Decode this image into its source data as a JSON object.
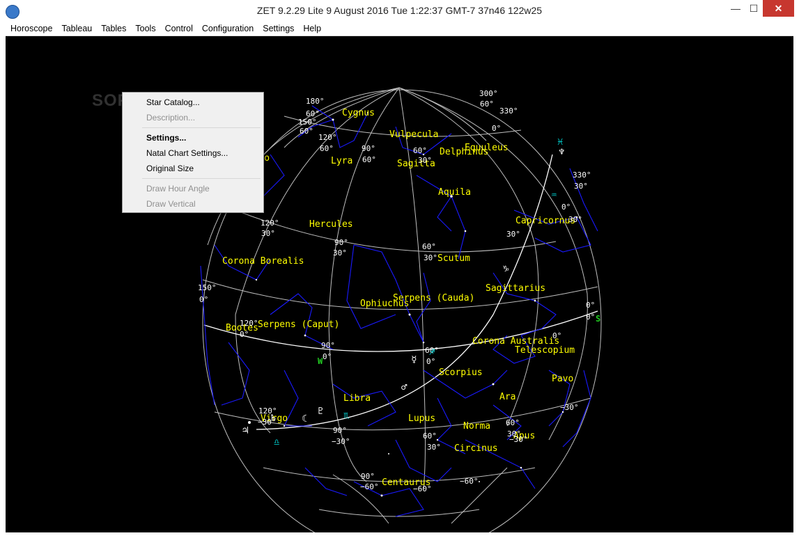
{
  "window": {
    "title": "ZET 9.2.29 Lite     9 August 2016  Tue    1:22:37 GMT-7 37n46   122w25",
    "min_glyph": "—",
    "max_glyph": "☐",
    "close_glyph": "✕"
  },
  "menu": [
    "Horoscope",
    "Tableau",
    "Tables",
    "Tools",
    "Control",
    "Configuration",
    "Settings",
    "Help"
  ],
  "context_menu": {
    "items": [
      {
        "label": "Star Catalog...",
        "enabled": true,
        "bold": false
      },
      {
        "label": "Description...",
        "enabled": false,
        "bold": false
      },
      {
        "label": "Settings...",
        "enabled": true,
        "bold": true
      },
      {
        "label": "Natal Chart Settings...",
        "enabled": true,
        "bold": false
      },
      {
        "label": "Original Size",
        "enabled": true,
        "bold": false
      },
      {
        "label": "Draw Hour Angle",
        "enabled": false,
        "bold": false
      },
      {
        "label": "Draw Vertical",
        "enabled": false,
        "bold": false
      }
    ]
  },
  "watermark": "SOFTPEDIA",
  "constellations": [
    "Cygnus",
    "Vulpecula",
    "Delphinus",
    "Equuleus",
    "Draco",
    "Lyra",
    "Sagitta",
    "Aquila",
    "Hercules",
    "Capricornus",
    "Corona Borealis",
    "Scutum",
    "Sagittarius",
    "Ophiuchus",
    "Serpens (Cauda)",
    "Bootes",
    "Serpens (Caput)",
    "Corona Australis",
    "Telescopium",
    "Scorpius",
    "Pavo",
    "Libra",
    "Ara",
    "Virgo",
    "Lupus",
    "Norma",
    "Apus",
    "Circinus",
    "Centaurus"
  ],
  "grid_labels": [
    "300°",
    "330°",
    "180°",
    "60°",
    "150°",
    "60°",
    "0°",
    "120°",
    "60°",
    "90°",
    "60°",
    "60°",
    "60°",
    "30°",
    "330°",
    "30°",
    "0°",
    "30°",
    "120°",
    "30°",
    "90°",
    "60°",
    "30°",
    "30°",
    "30°",
    "150°",
    "0°",
    "0°",
    "0°",
    "120°",
    "0°",
    "90°",
    "0°",
    "60°",
    "0°",
    "0°",
    "−30°",
    "120°",
    "−30°",
    "90°",
    "−30°",
    "60°",
    "30°",
    "−30°",
    "60°",
    "30°",
    "90°",
    "−60°",
    "−60°",
    "−60°"
  ],
  "horizon_markers": [
    "W",
    "S"
  ],
  "symbols": [
    "♓",
    "♆",
    "♒",
    "♑",
    "♐",
    "☿",
    "♂",
    "☾",
    "♇",
    "♏",
    "♎",
    "♃",
    "♄"
  ],
  "colors": {
    "sky_background": "#000000",
    "constellation_label": "#ffff00",
    "grid_label": "#ffffff",
    "constellation_lines": "#1a1aff",
    "grid_lines": "#bfbfbf",
    "ecliptic": "#ffffff",
    "horizon_marker": "#22cc22",
    "zodiac_symbol": "#00c8c8"
  }
}
